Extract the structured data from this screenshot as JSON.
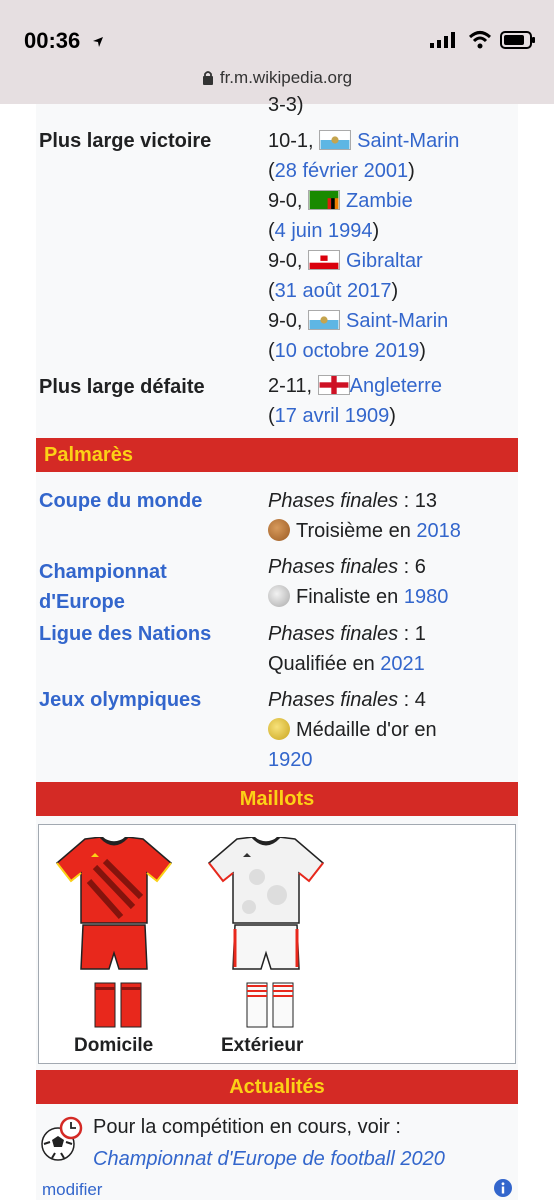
{
  "status": {
    "time": "00:36",
    "url": "fr.m.wikipedia.org"
  },
  "records": {
    "cut_top": "3-3)",
    "largest_win_label": "Plus large victoire",
    "wins": [
      {
        "score": "10-1,",
        "team": "Saint-Marin",
        "date": "28 février 2001"
      },
      {
        "score": "9-0,",
        "team": "Zambie",
        "date": "4 juin 1994"
      },
      {
        "score": "9-0,",
        "team": "Gibraltar",
        "date": "31 août 2017"
      },
      {
        "score": "9-0,",
        "team": "Saint-Marin",
        "date": "10 octobre 2019"
      }
    ],
    "largest_loss_label": "Plus large défaite",
    "loss": {
      "score": "2-11,",
      "team": "Angleterre",
      "date": "17 avril 1909"
    }
  },
  "palmares": {
    "title": "Palmarès",
    "items": [
      {
        "name": "Coupe du monde",
        "phases_label": "Phases finales",
        "phases": " : 13",
        "result": "Troisième en ",
        "year": "2018"
      },
      {
        "name_line1": "Championnat",
        "name_line2": "d'Europe",
        "phases_label": "Phases finales",
        "phases": " : 6",
        "result": "Finaliste en ",
        "year": "1980"
      },
      {
        "name": "Ligue des Nations",
        "phases_label": "Phases finales",
        "phases": " : 1",
        "result": "Qualifiée en ",
        "year": "2021"
      },
      {
        "name": "Jeux olympiques",
        "phases_label": "Phases finales",
        "phases": " : 4",
        "result": "Médaille d'or en",
        "year": "1920"
      }
    ]
  },
  "maillots": {
    "title": "Maillots",
    "home": "Domicile",
    "away": "Extérieur"
  },
  "actualites": {
    "title": "Actualités",
    "text": "Pour la compétition en cours, voir :",
    "link": "Championnat d'Europe de football 2020"
  },
  "footer": {
    "edit": "modifier"
  },
  "colors": {
    "header_bg": "#d42a25",
    "header_text": "#fcd116",
    "link": "#3366cc"
  }
}
